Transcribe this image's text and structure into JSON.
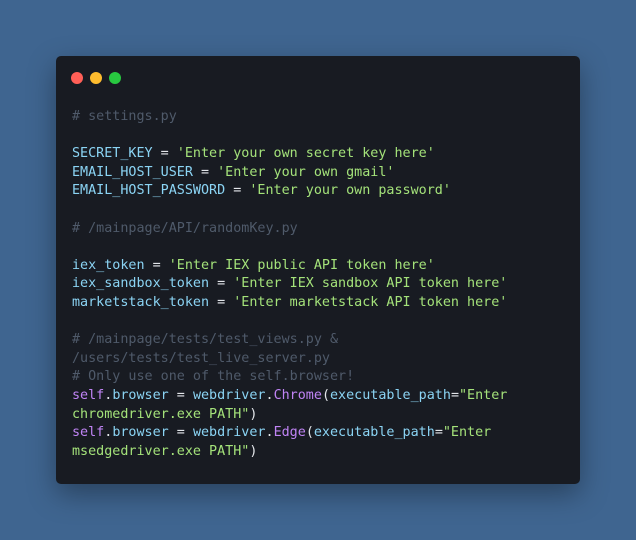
{
  "window": {
    "controls": [
      "close",
      "minimize",
      "maximize"
    ],
    "colors": {
      "background": "#3f6590",
      "editor": "#181b22",
      "close": "#ff5f57",
      "minimize": "#febc2e",
      "maximize": "#28c840",
      "comment": "#4f5a6a",
      "identifier": "#8bd4f4",
      "string": "#a4e27a",
      "keyword": "#c084f5"
    }
  },
  "code": {
    "comment_settings": "# settings.py",
    "secret_key_var": "SECRET_KEY",
    "secret_key_val": "'Enter your own secret key here'",
    "email_user_var": "EMAIL_HOST_USER",
    "email_user_val": "'Enter your own gmail'",
    "email_pass_var": "EMAIL_HOST_PASSWORD",
    "email_pass_val": "'Enter your own password'",
    "comment_randomkey": "# /mainpage/API/randomKey.py",
    "iex_token_var": "iex_token",
    "iex_token_val": "'Enter IEX public API token here'",
    "iex_sandbox_var": "iex_sandbox_token",
    "iex_sandbox_val": "'Enter IEX sandbox API token here'",
    "marketstack_var": "marketstack_token",
    "marketstack_val": "'Enter marketstack API token here'",
    "comment_tests_1": "# /mainpage/tests/test_views.py &",
    "comment_tests_2": "/users/tests/test_live_server.py",
    "comment_tests_3": "# Only use one of the self.browser!",
    "self_kw": "self",
    "browser_attr": "browser",
    "webdriver": "webdriver",
    "chrome_call": "Chrome",
    "edge_call": "Edge",
    "param_name": "executable_path",
    "chrome_path_1": "\"Enter",
    "chrome_path_2": "chromedriver.exe PATH\"",
    "edge_path_1": "\"Enter",
    "edge_path_2": "msedgedriver.exe PATH\""
  }
}
